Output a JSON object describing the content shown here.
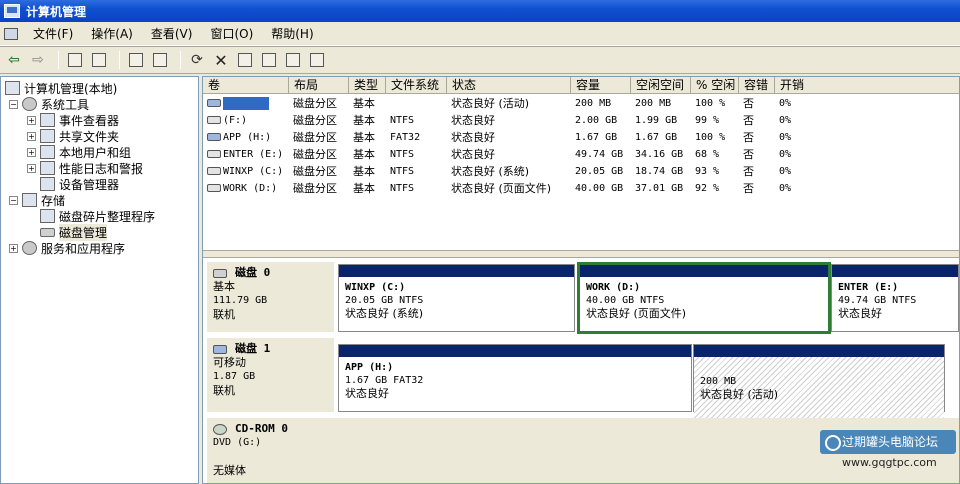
{
  "window": {
    "title": "计算机管理"
  },
  "menu": [
    "文件(F)",
    "操作(A)",
    "查看(V)",
    "窗口(O)",
    "帮助(H)"
  ],
  "toolbar": [
    "back-icon",
    "forward-icon",
    "up-icon",
    "show-hide-tree-icon",
    "properties-icon",
    "help-icon",
    "refresh-icon",
    "delete-icon",
    "properties-sheet-icon",
    "open-icon",
    "find-icon",
    "export-icon"
  ],
  "tree": {
    "root": "计算机管理(本地)",
    "system_tools": "系统工具",
    "event_viewer": "事件查看器",
    "shared_folders": "共享文件夹",
    "local_users": "本地用户和组",
    "perf_logs": "性能日志和警报",
    "device_manager": "设备管理器",
    "storage": "存储",
    "defrag": "磁盘碎片整理程序",
    "disk_mgmt": "磁盘管理",
    "services": "服务和应用程序"
  },
  "volume_table": {
    "headers": [
      "卷",
      "布局",
      "类型",
      "文件系统",
      "状态",
      "容量",
      "空闲空间",
      "% 空闲",
      "容错",
      "开销"
    ],
    "rows": [
      {
        "name": "",
        "layout": "磁盘分区",
        "type": "基本",
        "fs": "",
        "status": "状态良好 (活动)",
        "capacity": "200 MB",
        "free": "200 MB",
        "pct": "100 %",
        "ft": "否",
        "overhead": "0%"
      },
      {
        "name": "(F:)",
        "layout": "磁盘分区",
        "type": "基本",
        "fs": "NTFS",
        "status": "状态良好",
        "capacity": "2.00 GB",
        "free": "1.99 GB",
        "pct": "99 %",
        "ft": "否",
        "overhead": "0%"
      },
      {
        "name": "APP (H:)",
        "layout": "磁盘分区",
        "type": "基本",
        "fs": "FAT32",
        "status": "状态良好",
        "capacity": "1.67 GB",
        "free": "1.67 GB",
        "pct": "100 %",
        "ft": "否",
        "overhead": "0%"
      },
      {
        "name": "ENTER (E:)",
        "layout": "磁盘分区",
        "type": "基本",
        "fs": "NTFS",
        "status": "状态良好",
        "capacity": "49.74 GB",
        "free": "34.16 GB",
        "pct": "68 %",
        "ft": "否",
        "overhead": "0%"
      },
      {
        "name": "WINXP (C:)",
        "layout": "磁盘分区",
        "type": "基本",
        "fs": "NTFS",
        "status": "状态良好 (系统)",
        "capacity": "20.05 GB",
        "free": "18.74 GB",
        "pct": "93 %",
        "ft": "否",
        "overhead": "0%"
      },
      {
        "name": "WORK (D:)",
        "layout": "磁盘分区",
        "type": "基本",
        "fs": "NTFS",
        "status": "状态良好 (页面文件)",
        "capacity": "40.00 GB",
        "free": "37.01 GB",
        "pct": "92 %",
        "ft": "否",
        "overhead": "0%"
      }
    ]
  },
  "disks": {
    "disk0": {
      "name": "磁盘 0",
      "type": "基本",
      "size": "111.79 GB",
      "state": "联机"
    },
    "disk1": {
      "name": "磁盘 1",
      "type": "可移动",
      "size": "1.87 GB",
      "state": "联机"
    },
    "cdrom": {
      "name": "CD-ROM 0",
      "type": "DVD (G:)",
      "state": "无媒体"
    }
  },
  "partitions": {
    "c": {
      "name": "WINXP (C:)",
      "size": "20.05 GB NTFS",
      "status": "状态良好 (系统)"
    },
    "d": {
      "name": "WORK (D:)",
      "size": "40.00 GB NTFS",
      "status": "状态良好 (页面文件)"
    },
    "e": {
      "name": "ENTER (E:)",
      "size": "49.74 GB NTFS",
      "status": "状态良好"
    },
    "h": {
      "name": "APP (H:)",
      "size": "1.67 GB FAT32",
      "status": "状态良好"
    },
    "unnamed": {
      "size": "200 MB",
      "status": "状态良好 (活动)"
    }
  },
  "watermark": {
    "title": "过期罐头电脑论坛",
    "url": "www.gqgtpc.com"
  }
}
